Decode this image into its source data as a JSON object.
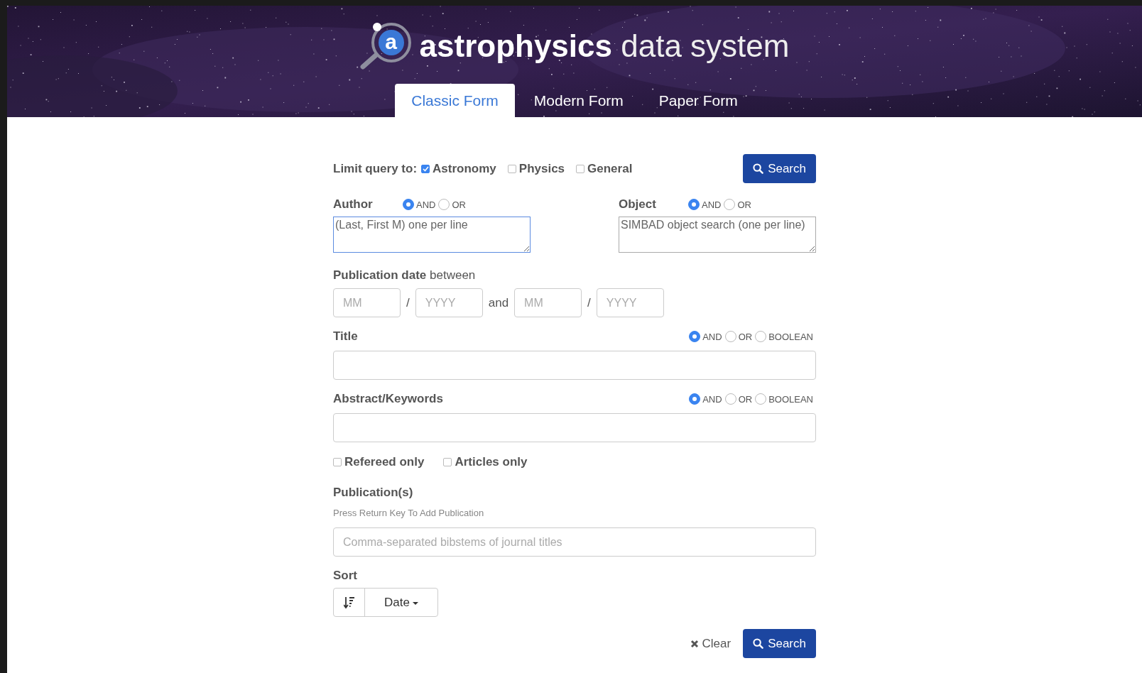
{
  "header": {
    "logo_letter": "a",
    "title_bold": "astrophysics",
    "title_light": "data system"
  },
  "tabs": [
    {
      "label": "Classic Form",
      "selected": true
    },
    {
      "label": "Modern Form",
      "selected": false
    },
    {
      "label": "Paper Form",
      "selected": false
    }
  ],
  "limit": {
    "label": "Limit query to:",
    "options": [
      {
        "label": "Astronomy",
        "checked": true
      },
      {
        "label": "Physics",
        "checked": false
      },
      {
        "label": "General",
        "checked": false
      }
    ]
  },
  "top_search_button": "Search",
  "author": {
    "label": "Author",
    "operators": [
      {
        "label": "AND",
        "selected": true
      },
      {
        "label": "OR",
        "selected": false
      }
    ],
    "placeholder": "(Last, First M) one per line",
    "focused": true
  },
  "object": {
    "label": "Object",
    "operators": [
      {
        "label": "AND",
        "selected": true
      },
      {
        "label": "OR",
        "selected": false
      }
    ],
    "placeholder": "SIMBAD object search (one per line)",
    "focused": false
  },
  "publication_date": {
    "label": "**Publication date** between",
    "fields": [
      {
        "kind": "input",
        "placeholder": "MM"
      },
      {
        "kind": "text",
        "text": "/"
      },
      {
        "kind": "input",
        "placeholder": "YYYY"
      },
      {
        "kind": "text",
        "text": "and"
      },
      {
        "kind": "input",
        "placeholder": "MM"
      },
      {
        "kind": "text",
        "text": "/"
      },
      {
        "kind": "input",
        "placeholder": "YYYY"
      }
    ]
  },
  "title": {
    "label": "Title",
    "operators": [
      {
        "label": "AND",
        "selected": true
      },
      {
        "label": "OR",
        "selected": false
      },
      {
        "label": "BOOLEAN",
        "selected": false
      }
    ]
  },
  "abstract": {
    "label": "Abstract/Keywords",
    "operators": [
      {
        "label": "AND",
        "selected": true
      },
      {
        "label": "OR",
        "selected": false
      },
      {
        "label": "BOOLEAN",
        "selected": false
      }
    ]
  },
  "filters": [
    {
      "label": "Refereed only",
      "checked": false
    },
    {
      "label": "Articles only",
      "checked": false
    }
  ],
  "publications": {
    "label": "Publication(s)",
    "hint": "Press Return Key To Add Publication",
    "placeholder": "Comma-separated bibstems of journal titles"
  },
  "sort": {
    "label": "Sort",
    "value": "Date"
  },
  "actions": [
    {
      "kind": "link",
      "label": "Clear"
    },
    {
      "kind": "primary",
      "label": "Search"
    }
  ]
}
